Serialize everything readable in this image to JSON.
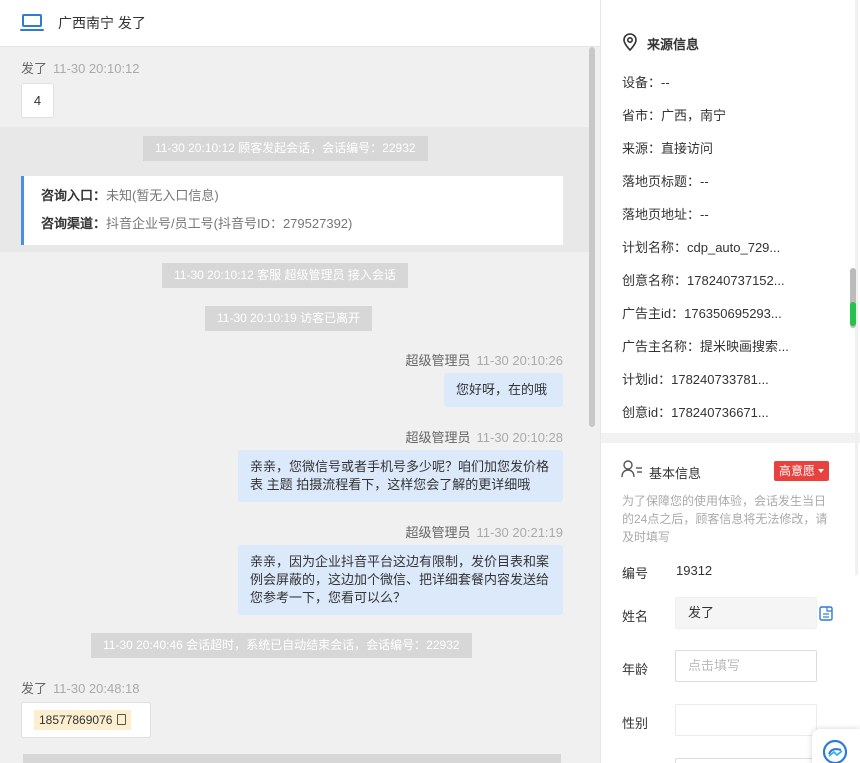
{
  "chat": {
    "header_title": "广西南宁  发了",
    "messages": {
      "m1": {
        "sender": "发了",
        "time": "11-30 20:10:12",
        "text": "4"
      },
      "sys1": "11-30 20:10:12 顾客发起会话，会话编号：22932",
      "entry": {
        "label1": "咨询入口：",
        "value1": "未知(暂无入口信息)",
        "label2": "咨询渠道：",
        "value2": "抖音企业号/员工号(抖音号ID：279527392)"
      },
      "sys2": "11-30 20:10:12 客服 超级管理员 接入会话",
      "sys3": "11-30 20:10:19 访客已离开",
      "m2": {
        "sender": "超级管理员",
        "time": "11-30 20:10:26",
        "text": "您好呀，在的哦"
      },
      "m3": {
        "sender": "超级管理员",
        "time": "11-30 20:10:28",
        "line1": "亲亲，您微信号或者手机号多少呢？咱们加您发价格",
        "line2": "表 主题 拍摄流程看下，这样您会了解的更详细哦"
      },
      "m4": {
        "sender": "超级管理员",
        "time": "11-30 20:21:19",
        "line1": "亲亲，因为企业抖音平台这边有限制，发价目表和案",
        "line2": "例会屏蔽的，这边加个微信、把详细套餐内容发送给",
        "line3": "您参考一下，您看可以么？"
      },
      "sys4": "11-30 20:40:46 会话超时，系统已自动结束会话，会话编号：22932",
      "m5": {
        "sender": "发了",
        "time": "11-30 20:48:18",
        "text": "18577869076"
      }
    }
  },
  "panel": {
    "source": {
      "title": "来源信息",
      "rows": [
        "设备：--",
        "省市：广西，南宁",
        "来源：直接访问",
        "落地页标题：--",
        "落地页地址：--",
        "计划名称：cdp_auto_729...",
        "创意名称：178240737152...",
        "广告主id：176350695293...",
        "广告主名称：提米映画搜索...",
        "计划id：178240733781...",
        "创意id：178240736671..."
      ]
    },
    "basic": {
      "title": "基本信息",
      "badge": "高意愿",
      "note": "为了保障您的使用体验，会话发生当日的24点之后，顾客信息将无法修改，请及时填写",
      "id_label": "编号",
      "id_value": "19312",
      "name_label": "姓名",
      "name_value": "发了",
      "age_label": "年龄",
      "age_placeholder": "点击填写",
      "gender_label": "性别"
    }
  },
  "colors": {
    "accent": "#2e7bd6",
    "badge": "#e8423f",
    "bubble_out": "#dce9fb",
    "system_bar": "#d7d7d7"
  }
}
